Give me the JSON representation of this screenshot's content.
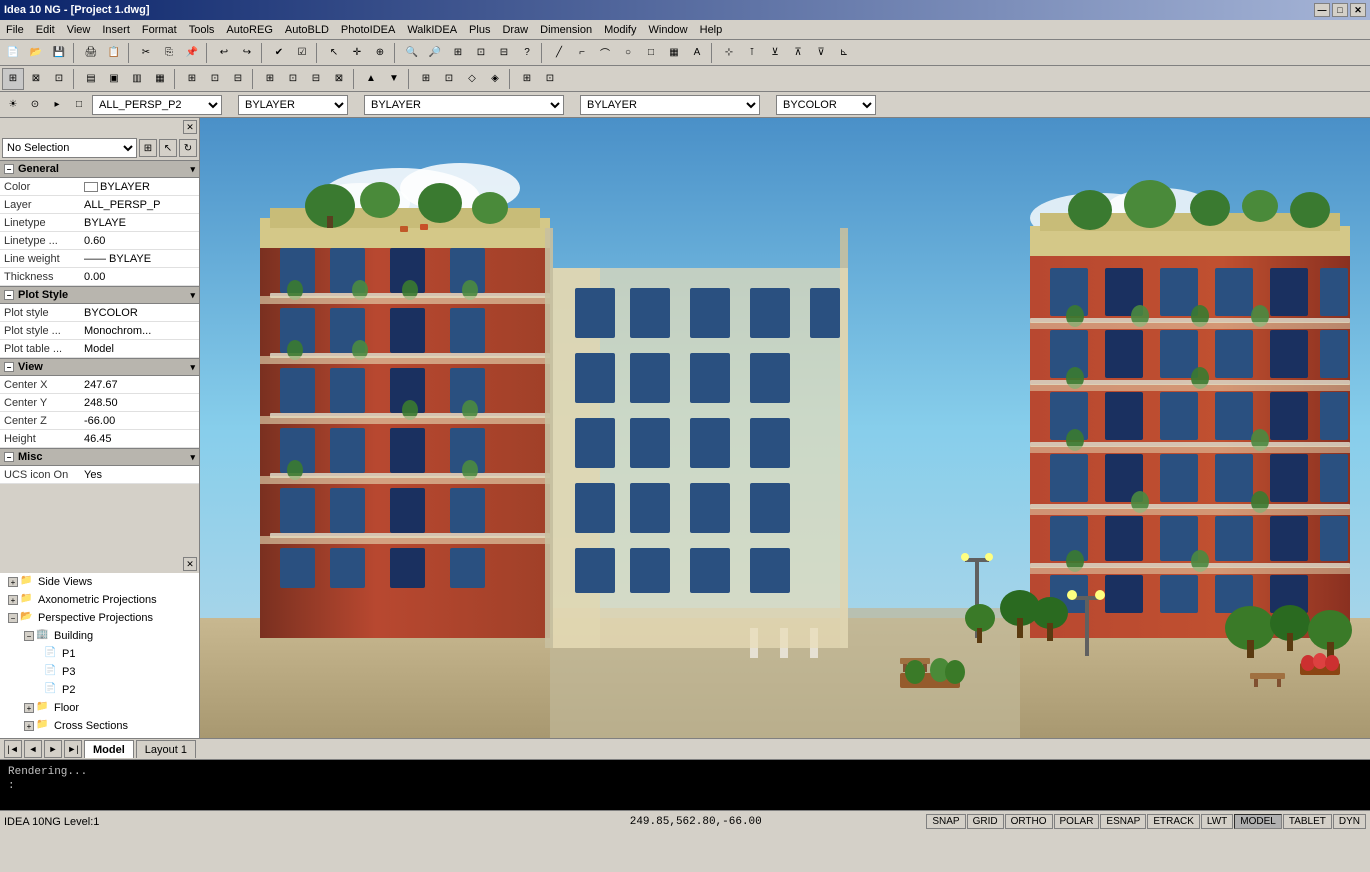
{
  "titleBar": {
    "title": "Idea 10 NG - [Project 1.dwg]",
    "minBtn": "—",
    "maxBtn": "□",
    "closeBtn": "✕"
  },
  "menuBar": {
    "items": [
      "File",
      "Edit",
      "View",
      "Insert",
      "Format",
      "Tools",
      "AutoREG",
      "AutoBLD",
      "PhotoIDEA",
      "WalkIDEA",
      "Plus",
      "Draw",
      "Dimension",
      "Modify",
      "Window",
      "Help"
    ]
  },
  "layerToolbar": {
    "icon1": "◐",
    "icon2": "⊙",
    "layerName": "ALL_PERSP_P2",
    "colorLabel": "BYLAYER",
    "linetypeLabel": "BYLAYER",
    "lineweightLabel": "BYLAYER",
    "plotStyleLabel": "BYCOLOR"
  },
  "propertiesPanel": {
    "selectionLabel": "No Selection",
    "sections": {
      "general": {
        "label": "General",
        "properties": [
          {
            "label": "Color",
            "value": "BYLAYER",
            "hasColor": true
          },
          {
            "label": "Layer",
            "value": "ALL_PERSP_P"
          },
          {
            "label": "Linetype",
            "value": "BYLAYE"
          },
          {
            "label": "Linetype ...",
            "value": "0.60"
          },
          {
            "label": "Line weight",
            "value": "—— BYLAYE"
          },
          {
            "label": "Thickness",
            "value": "0.00"
          }
        ]
      },
      "plotStyle": {
        "label": "Plot Style",
        "properties": [
          {
            "label": "Plot style",
            "value": "BYCOLOR"
          },
          {
            "label": "Plot style ...",
            "value": "Monochrom..."
          },
          {
            "label": "Plot table ...",
            "value": "Model"
          }
        ]
      },
      "view": {
        "label": "View",
        "properties": [
          {
            "label": "Center X",
            "value": "247.67"
          },
          {
            "label": "Center Y",
            "value": "248.50"
          },
          {
            "label": "Center Z",
            "value": "-66.00"
          },
          {
            "label": "Height",
            "value": "46.45"
          }
        ]
      },
      "misc": {
        "label": "Misc",
        "properties": [
          {
            "label": "UCS icon On",
            "value": "Yes"
          }
        ]
      }
    }
  },
  "treePanel": {
    "items": [
      {
        "label": "Side Views",
        "level": 0,
        "expanded": false,
        "type": "folder"
      },
      {
        "label": "Axonometric Projections",
        "level": 0,
        "expanded": false,
        "type": "folder"
      },
      {
        "label": "Perspective Projections",
        "level": 0,
        "expanded": true,
        "type": "folder"
      },
      {
        "label": "Building",
        "level": 1,
        "expanded": true,
        "type": "building"
      },
      {
        "label": "P1",
        "level": 2,
        "expanded": false,
        "type": "item"
      },
      {
        "label": "P3",
        "level": 2,
        "expanded": false,
        "type": "item"
      },
      {
        "label": "P2",
        "level": 2,
        "expanded": false,
        "type": "item"
      },
      {
        "label": "Floor",
        "level": 1,
        "expanded": false,
        "type": "folder"
      },
      {
        "label": "Cross Sections",
        "level": 1,
        "expanded": false,
        "type": "folder"
      }
    ]
  },
  "navBar": {
    "tabs": [
      {
        "label": "Model",
        "active": true
      },
      {
        "label": "Layout 1",
        "active": false
      }
    ]
  },
  "statusBar": {
    "leftText": "IDEA 10NG Level:1",
    "coordinates": "249.85,562.80,-66.00",
    "buttons": [
      "SNAP",
      "GRID",
      "ORTHO",
      "POLAR",
      "ESNAP",
      "ETRACK",
      "LWT",
      "MODEL",
      "TABLET",
      "DYN"
    ]
  },
  "commandLine": {
    "line1": "Rendering...",
    "line2": ":"
  }
}
